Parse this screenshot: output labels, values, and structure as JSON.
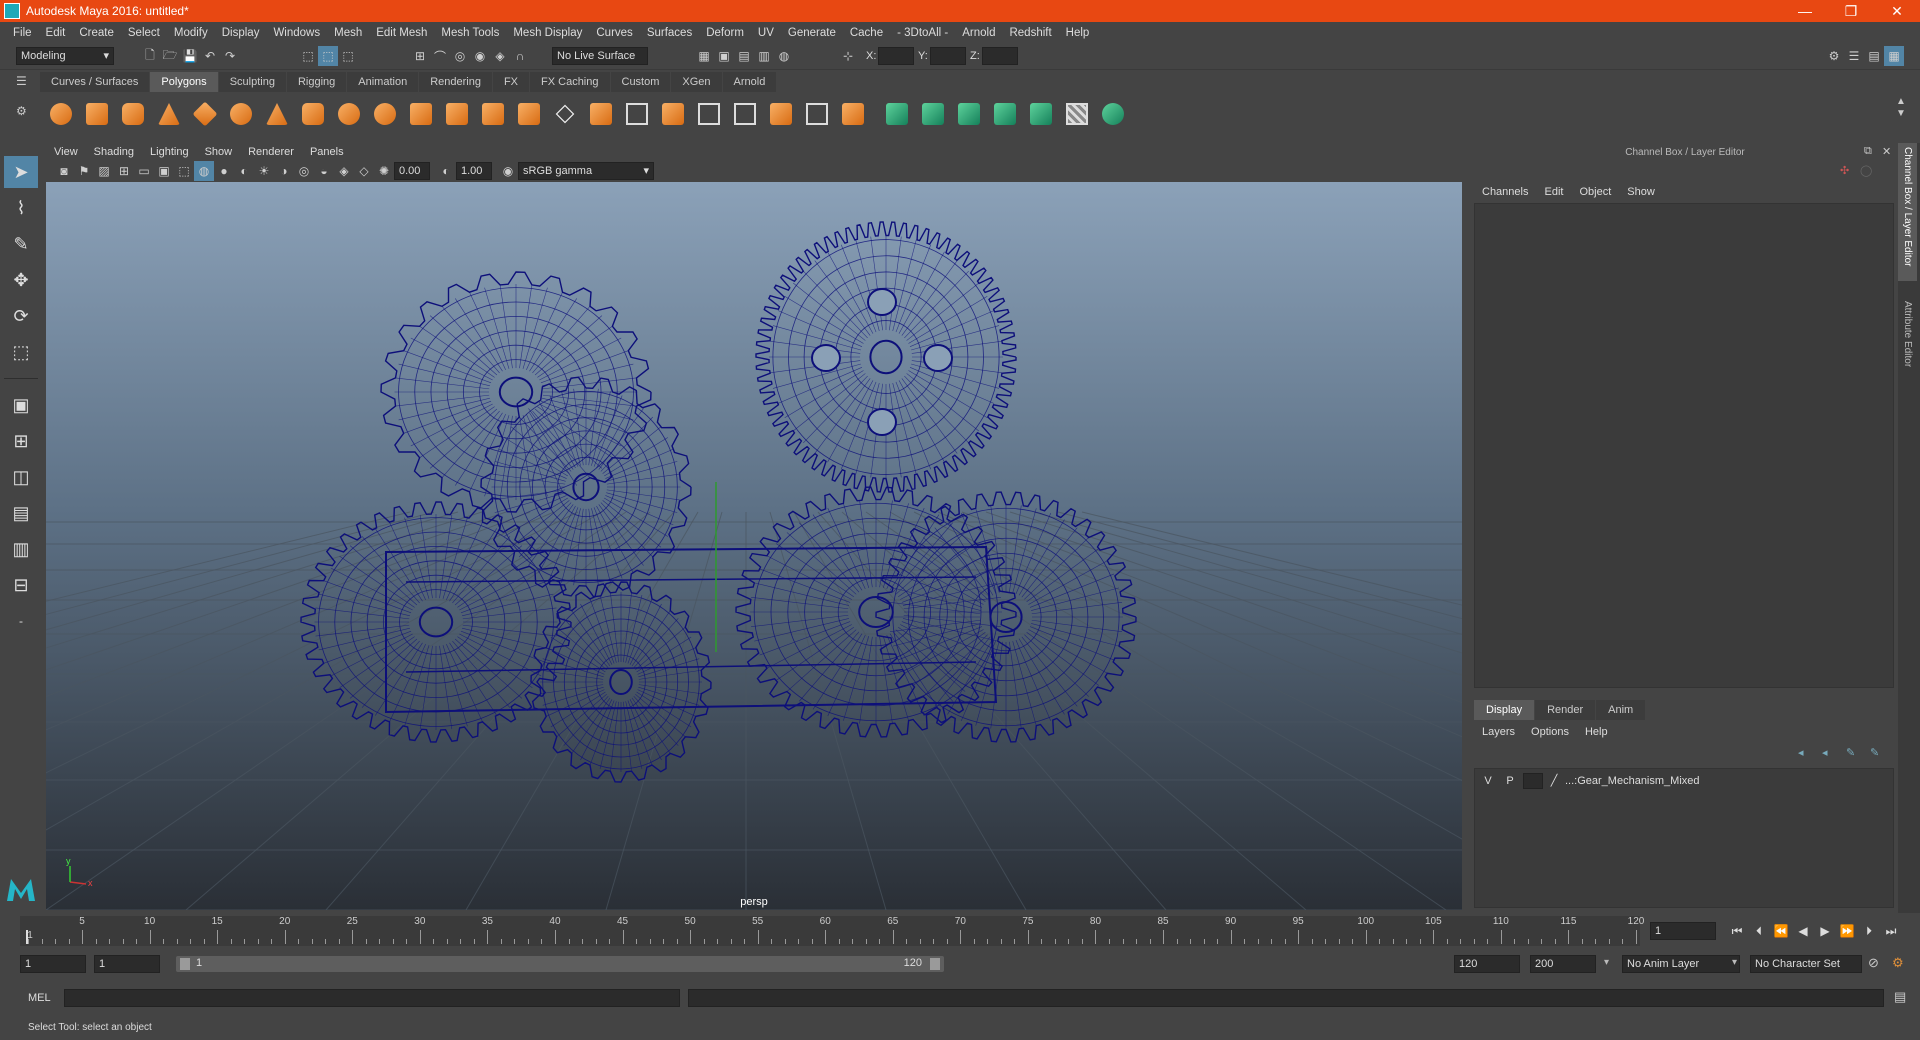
{
  "window": {
    "title": "Autodesk Maya 2016: untitled*",
    "controls": [
      "—",
      "❐",
      "✕"
    ]
  },
  "menubar": [
    "File",
    "Edit",
    "Create",
    "Select",
    "Modify",
    "Display",
    "Windows",
    "Mesh",
    "Edit Mesh",
    "Mesh Tools",
    "Mesh Display",
    "Curves",
    "Surfaces",
    "Deform",
    "UV",
    "Generate",
    "Cache",
    "- 3DtoAll -",
    "Arnold",
    "Redshift",
    "Help"
  ],
  "statusline": {
    "mode": "Modeling",
    "live_surface": "No Live Surface",
    "x_label": "X:",
    "y_label": "Y:",
    "z_label": "Z:"
  },
  "shelf_tabs": [
    {
      "label": "Curves / Surfaces",
      "active": false
    },
    {
      "label": "Polygons",
      "active": true
    },
    {
      "label": "Sculpting",
      "active": false
    },
    {
      "label": "Rigging",
      "active": false
    },
    {
      "label": "Animation",
      "active": false
    },
    {
      "label": "Rendering",
      "active": false
    },
    {
      "label": "FX",
      "active": false
    },
    {
      "label": "FX Caching",
      "active": false
    },
    {
      "label": "Custom",
      "active": false
    },
    {
      "label": "XGen",
      "active": false
    },
    {
      "label": "Arnold",
      "active": false
    }
  ],
  "viewport": {
    "menu": [
      "View",
      "Shading",
      "Lighting",
      "Show",
      "Renderer",
      "Panels"
    ],
    "exposure": "0.00",
    "gamma": "1.00",
    "color_space": "sRGB gamma",
    "camera_label": "persp",
    "wire_color": "#0d0f7a",
    "axis_x": "x",
    "axis_y": "y"
  },
  "channel_box": {
    "title": "Channel Box / Layer Editor",
    "menu": [
      "Channels",
      "Edit",
      "Object",
      "Show"
    ],
    "side_tabs": [
      "Channel Box / Layer Editor",
      "Attribute Editor"
    ]
  },
  "layer_editor": {
    "tabs": [
      {
        "label": "Display",
        "active": true
      },
      {
        "label": "Render",
        "active": false
      },
      {
        "label": "Anim",
        "active": false
      }
    ],
    "menu": [
      "Layers",
      "Options",
      "Help"
    ],
    "layers": [
      {
        "v": "V",
        "p": "P",
        "name": "...:Gear_Mechanism_Mixed"
      }
    ]
  },
  "timeline": {
    "ticks": [
      5,
      10,
      15,
      20,
      25,
      30,
      35,
      40,
      45,
      50,
      55,
      60,
      65,
      70,
      75,
      80,
      85,
      90,
      95,
      100,
      105,
      110,
      115,
      120
    ],
    "first_label": "1",
    "current_frame": "1",
    "start": 1,
    "end": 120
  },
  "range": {
    "start_time": "1",
    "playback_start": "1",
    "slider_start": "1",
    "slider_end": "120",
    "playback_end": "120",
    "end_time": "200",
    "anim_layer": "No Anim Layer",
    "character_set": "No Character Set"
  },
  "command_line": {
    "label": "MEL"
  },
  "help_line": "Select Tool: select an object"
}
